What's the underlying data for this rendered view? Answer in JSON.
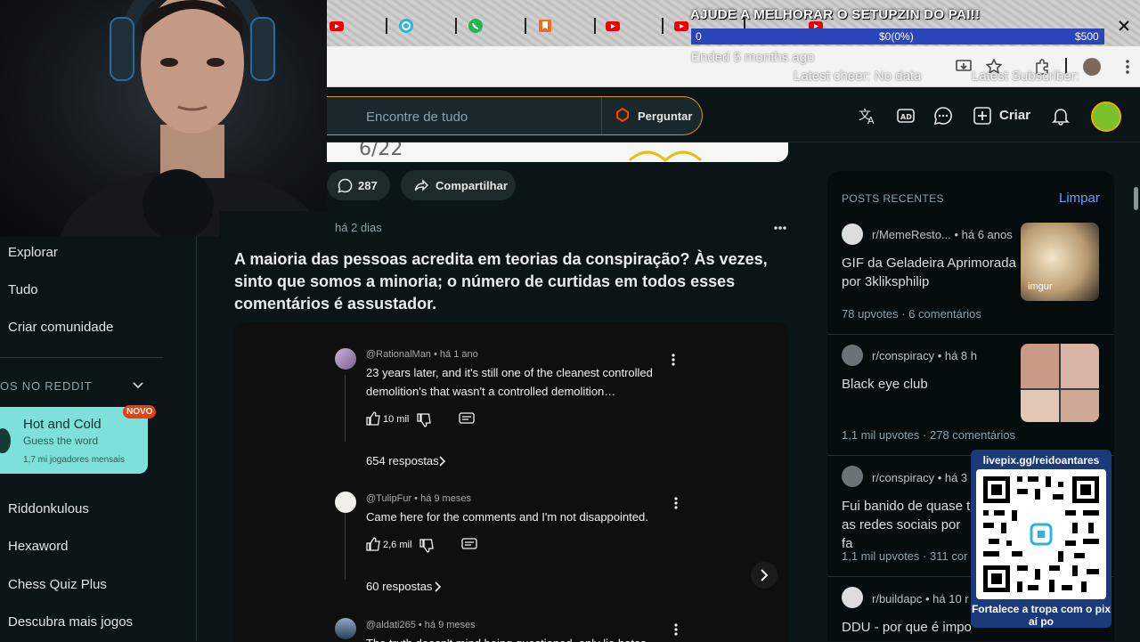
{
  "overlay": {
    "donation_title": "AJUDE A MELHORAR O SETUPZIN DO PAI!!",
    "goal_min": "0",
    "goal_current": "$0(0%)",
    "goal_max": "$500",
    "ended": "Ended 5 months ago",
    "latest_cheer": "Latest cheer: No data",
    "latest_subscriber": "Latest Subscriber:",
    "qr_url": "livepix.gg/reidoantares",
    "qr_cta": "Fortalece a tropa com o pix aí po"
  },
  "header": {
    "search_placeholder": "Encontre de tudo",
    "ask_label": "Perguntar",
    "create_label": "Criar"
  },
  "sidebar": {
    "items": [
      "Explorar",
      "Tudo",
      "Criar comunidade"
    ],
    "section_label": "OS NO REDDIT",
    "game_card": {
      "title": "Hot and Cold",
      "subtitle": "Guess the word",
      "players": "1,7 mi jogadores mensais",
      "badge": "NOVO"
    },
    "games": [
      "Riddonkulous",
      "Hexaword",
      "Chess Quiz Plus",
      "Descubra mais jogos"
    ]
  },
  "feed": {
    "prev_post": {
      "comments": "287",
      "share_label": "Compartilhar"
    },
    "post": {
      "time": "há 2 dias",
      "title": "A maioria das pessoas acredita em teorias da conspiração? Às vezes, sinto que somos a minoria; o número de curtidas em todos esses comentários é assustador.",
      "comments": [
        {
          "author": "@RationalMan",
          "time": "há 1 ano",
          "text": "23 years later, and it's still one of the cleanest controlled demolition's that wasn't a controlled demolition…",
          "likes": "10 mil",
          "replies": "654 respostas"
        },
        {
          "author": "@TulipFur",
          "time": "há 9 meses",
          "text": "Came here for the comments and I'm not disappointed.",
          "likes": "2,6 mil",
          "replies": "60 respostas"
        },
        {
          "author": "@aldati265",
          "time": "há 9 meses",
          "text": "The truth doesn't mind being questioned, only lie hates"
        }
      ]
    }
  },
  "recent": {
    "title": "POSTS RECENTES",
    "clear_label": "Limpar",
    "posts": [
      {
        "sub": "r/MemeResto...",
        "time": "há 6 anos",
        "title": "GIF da Geladeira Aprimorada por 3kliksphilip",
        "upvotes": "78 upvotes",
        "comments": "6 comentários",
        "thumb_label": "imgur"
      },
      {
        "sub": "r/conspiracy",
        "time": "há 8 h",
        "title": "Black eye club",
        "upvotes": "1,1 mil upvotes",
        "comments": "278 comentários"
      },
      {
        "sub": "r/conspiracy",
        "time": "há 3",
        "title": "Fui banido de quase t as redes sociais por fa",
        "upvotes": "1,1 mil upvotes",
        "comments": "311 cor"
      },
      {
        "sub": "r/buildapc",
        "time": "há 10 r",
        "title": "DDU - por que é impo"
      }
    ]
  }
}
